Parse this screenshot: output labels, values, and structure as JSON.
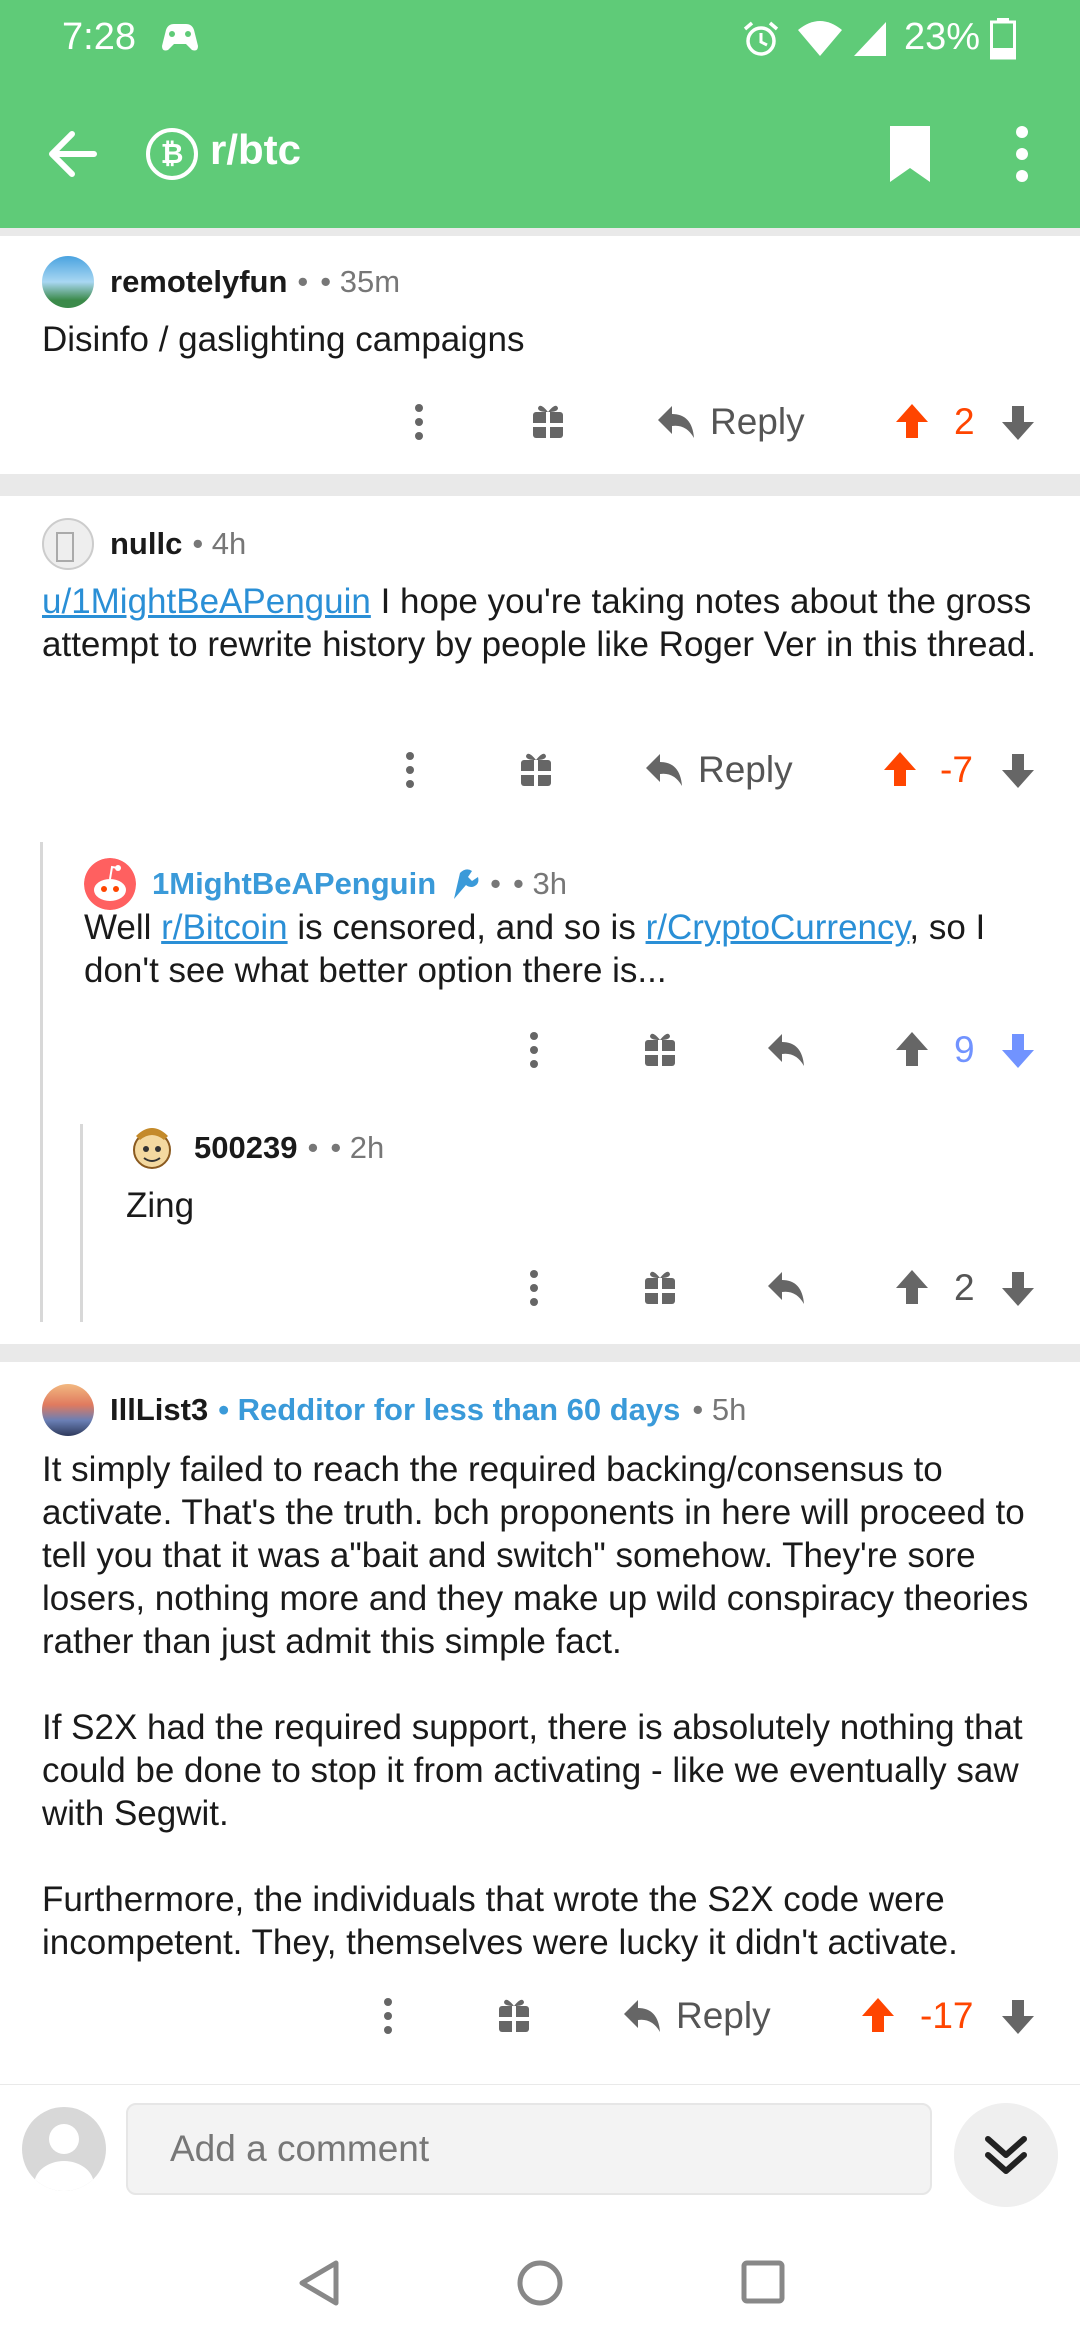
{
  "status_bar": {
    "time": "7:28",
    "battery": "23%"
  },
  "app_bar": {
    "subreddit": "r/btc",
    "subreddit_icon": "bitcoin-icon"
  },
  "comments": [
    {
      "author": "remotelyfun",
      "sep": "•",
      "age": "• 35m",
      "body": "Disinfo / gaslighting campaigns",
      "reply_label": "Reply",
      "score": "2"
    },
    {
      "author": "nullc",
      "age": "• 4h",
      "body_link": "u/1MightBeAPenguin",
      "body": " I hope you're taking notes about the gross attempt to rewrite history by people like Roger Ver in this thread.",
      "reply_label": "Reply",
      "score": "-7"
    },
    {
      "author": "1MightBeAPenguin",
      "sep": "•",
      "age": "• 3h",
      "body_parts": [
        "Well ",
        "r/Bitcoin",
        " is censored, and so is ",
        "r/CryptoCurrency",
        ", so I don't see what better option there is..."
      ],
      "score": "9"
    },
    {
      "author": "500239",
      "sep": "•",
      "age": "• 2h",
      "body": "Zing",
      "score": "2"
    },
    {
      "author": "IllList3",
      "flair": "• Redditor for less than 60 days",
      "age": "• 5h",
      "paragraphs": [
        "It simply failed to reach the required backing/consensus to activate.  That's the truth.  bch proponents in here will proceed to tell you that it was a\"bait and switch\" somehow. They're sore losers, nothing more and they make up wild conspiracy theories rather than just admit this simple fact.",
        "If S2X had the required support, there is absolutely nothing that could be done to stop it from activating - like we eventually saw with Segwit.",
        "Furthermore, the individuals that wrote the S2X code were incompetent. They, themselves were lucky it didn't activate."
      ],
      "reply_label": "Reply",
      "score": "-17"
    }
  ],
  "composer": {
    "placeholder": "Add a comment"
  },
  "colors": {
    "header_green": "#5fcb78",
    "upvote_orange": "#ff4500",
    "downvote_blue": "#7193ff",
    "link_blue": "#2a8fd6",
    "icon_gray": "#666666"
  }
}
